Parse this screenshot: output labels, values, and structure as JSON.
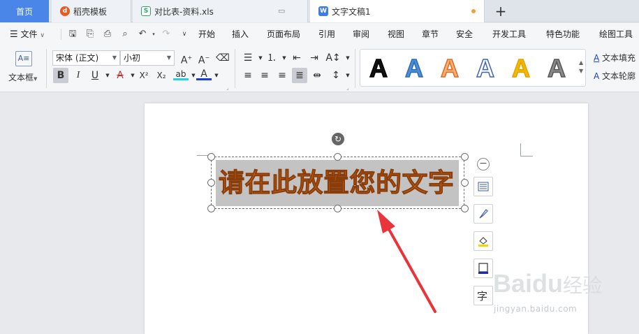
{
  "tabs": {
    "home": "首页",
    "daoke": "稻壳模板",
    "xls": "对比表-资料.xls",
    "doc": "文字文稿1",
    "add": "+"
  },
  "menu": {
    "file": "文件",
    "items": [
      "开始",
      "插入",
      "页面布局",
      "引用",
      "审阅",
      "视图",
      "章节",
      "安全",
      "开发工具",
      "特色功能",
      "绘图工具"
    ]
  },
  "ribbon": {
    "textbox_label": "文本框",
    "font_name": "宋体 (正文)",
    "font_size": "小初",
    "bold": "B",
    "italic": "I",
    "underline": "U",
    "strike": "A",
    "superscript": "X²",
    "subscript": "X₂",
    "highlight": "ab",
    "font_color": "A",
    "text_fill": "文本填充",
    "text_outline": "文本轮廓"
  },
  "wordart_styles": [
    {
      "letter": "A",
      "fill": "#111111",
      "stroke": "#000000"
    },
    {
      "letter": "A",
      "fill": "#4a8fd8",
      "stroke": "#2f6bb0"
    },
    {
      "letter": "A",
      "fill": "#f4b07a",
      "stroke": "#e06b20"
    },
    {
      "letter": "A",
      "fill": "#ffffff",
      "stroke": "#3f66b5"
    },
    {
      "letter": "A",
      "fill": "#f5b800",
      "stroke": "#e0a000"
    },
    {
      "letter": "A",
      "fill": "#8a8a8a",
      "stroke": "#555555"
    }
  ],
  "document": {
    "wordart_text": "请在此放置您的文字"
  },
  "side_tools": [
    "layout-icon",
    "brush-icon",
    "fill-icon",
    "frame-icon",
    "text-icon"
  ],
  "side_text_tool": "字",
  "watermark": {
    "text": "jingyan.baidu.com"
  },
  "colors": {
    "accent": "#4a86e8",
    "wordart_fill": "#d2681e",
    "arrow": "#e8343a"
  }
}
